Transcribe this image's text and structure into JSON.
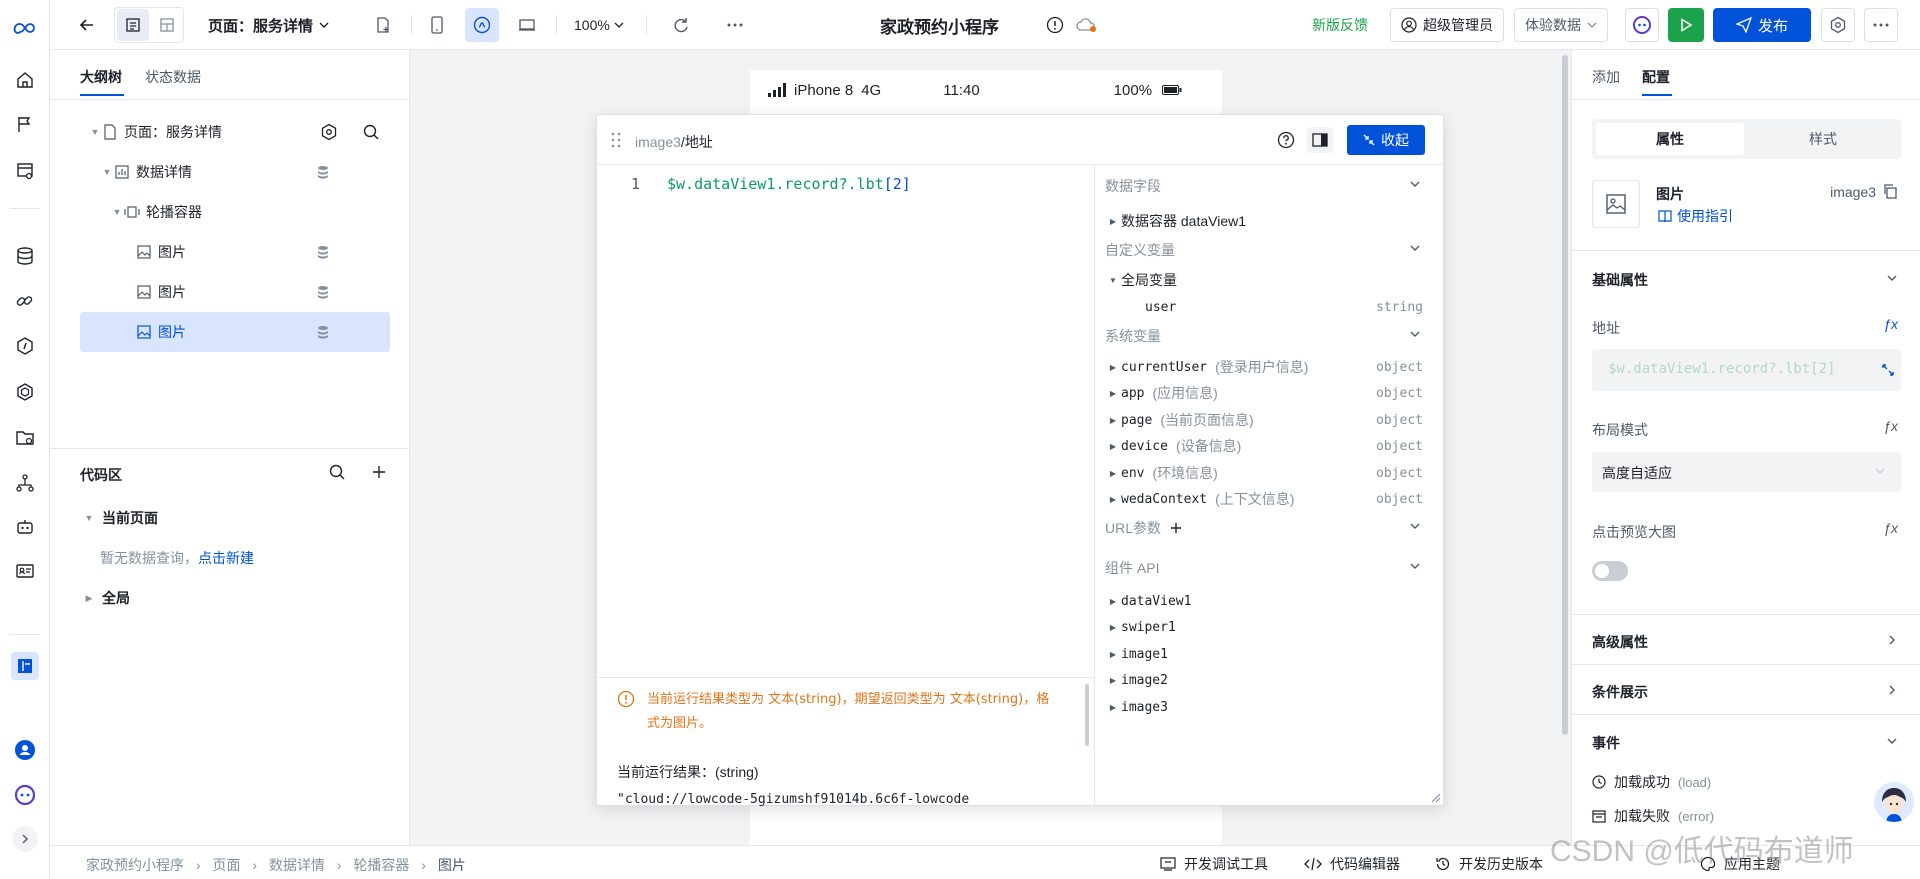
{
  "topbar": {
    "page_select": "页面：服务详情",
    "zoom": "100%",
    "app_title": "家政预约小程序",
    "feedback": "新版反馈",
    "user": "超级管理员",
    "data_mode": "体验数据",
    "publish": "发布"
  },
  "leftpanel": {
    "tabs": [
      "大纲树",
      "状态数据"
    ],
    "tree": [
      {
        "label": "页面：服务详情"
      },
      {
        "label": "数据详情"
      },
      {
        "label": "轮播容器"
      },
      {
        "label": "图片"
      },
      {
        "label": "图片"
      },
      {
        "label": "图片"
      }
    ],
    "code_title": "代码区",
    "current_page": "当前页面",
    "empty_text": "暂无数据查询，",
    "create_link": "点击新建",
    "global": "全局"
  },
  "phone": {
    "device": "iPhone 8",
    "network": "4G",
    "time": "11:40",
    "battery": "100%"
  },
  "editor": {
    "path_prefix": "image3",
    "path_sep": "/",
    "path_field": "地址",
    "collapse": "收起",
    "line_no": "1",
    "code_main": "$w.dataView1.record?.lbt",
    "code_index": "[2]",
    "warning": "当前运行结果类型为 文本(string)，期望返回类型为 文本(string)，格式为图片。",
    "result_label": "当前运行结果：(string)",
    "result_value": "\"cloud://lowcode-5gizumshf91014b.6c6f-lowcode",
    "sections": {
      "data_fields": "数据字段",
      "custom_vars": "自定义变量",
      "system_vars": "系统变量",
      "url_params": "URL参数",
      "component_api": "组件 API"
    },
    "data_container": {
      "name": "数据容器 dataView1"
    },
    "global_var": {
      "name": "全局变量"
    },
    "user_var": {
      "name": "user",
      "type": "string"
    },
    "system_vars": [
      {
        "name": "currentUser",
        "desc": "(登录用户信息)",
        "type": "object"
      },
      {
        "name": "app",
        "desc": "(应用信息)",
        "type": "object"
      },
      {
        "name": "page",
        "desc": "(当前页面信息)",
        "type": "object"
      },
      {
        "name": "device",
        "desc": "(设备信息)",
        "type": "object"
      },
      {
        "name": "env",
        "desc": "(环境信息)",
        "type": "object"
      },
      {
        "name": "wedaContext",
        "desc": "(上下文信息)",
        "type": "object"
      }
    ],
    "component_api": [
      "dataView1",
      "swiper1",
      "image1",
      "image2",
      "image3"
    ]
  },
  "rightpanel": {
    "tabs": [
      "添加",
      "配置"
    ],
    "seg": [
      "属性",
      "样式"
    ],
    "component_name": "图片",
    "component_id": "image3",
    "guide_link": "使用指引",
    "basic_props": "基础属性",
    "address_label": "地址",
    "address_value": "$w.dataView1.record?.lbt[2]",
    "layout_label": "布局模式",
    "layout_value": "高度自适应",
    "preview_label": "点击预览大图",
    "preview_enabled": false,
    "advanced": "高级属性",
    "conditional": "条件展示",
    "events": "事件",
    "events_list": [
      {
        "name": "加载成功",
        "code": "(load)"
      },
      {
        "name": "加载失败",
        "code": "(error)"
      }
    ]
  },
  "bottombar": {
    "breadcrumb": [
      "家政预约小程序",
      "页面",
      "数据详情",
      "轮播容器",
      "图片"
    ],
    "dev_tools": "开发调试工具",
    "code_editor": "代码编辑器",
    "history": "开发历史版本",
    "theme": "应用主题"
  },
  "watermark": "CSDN @低代码布道师",
  "colors": {
    "primary": "#0052d9",
    "green": "#1aa34a",
    "warning": "#e37318",
    "code_green": "#0a9b6c"
  }
}
